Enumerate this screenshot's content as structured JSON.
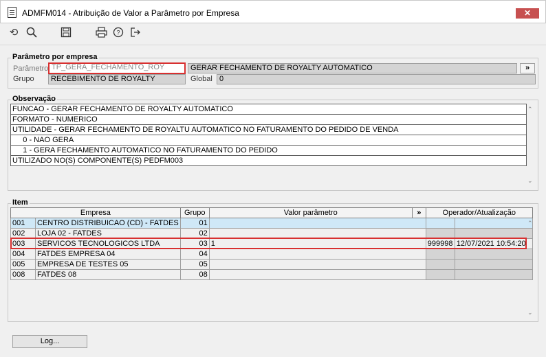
{
  "window": {
    "title": "ADMFM014 - Atribuição de Valor a Parâmetro por Empresa",
    "close_icon": "close-icon"
  },
  "toolbar": {
    "icons": [
      "refresh-icon",
      "search-icon",
      "save-icon",
      "print-icon",
      "help-icon",
      "exit-icon"
    ],
    "refresh_glyph": "⟲",
    "search_glyph": "🔍",
    "save_glyph": "💾",
    "print_glyph": "🖶",
    "help_glyph": "?",
    "exit_glyph": "↦"
  },
  "param_group": {
    "title": "Parâmetro por empresa",
    "parametro_label": "Parâmetro",
    "parametro_value": "TP_GERA_FECHAMENTO_ROY",
    "parametro_desc": "GERAR FECHAMENTO DE ROYALTY AUTOMATICO",
    "lookup_button": "»",
    "grupo_label": "Grupo",
    "grupo_value": "RECEBIMENTO DE ROYALTY",
    "global_label": "Global",
    "global_value": "0"
  },
  "observacao": {
    "title": "Observação",
    "lines": [
      "FUNCAO - GERAR FECHAMENTO DE ROYALTY AUTOMATICO",
      "FORMATO - NUMERICO",
      "UTILIDADE - GERAR FECHAMENTO DE ROYALTU AUTOMATICO NO FATURAMENTO DO PEDIDO DE VENDA",
      "     0 - NAO GERA",
      "     1 - GERA FECHAMENTO AUTOMATICO NO FATURAMENTO DO PEDIDO",
      "UTILIZADO NO(S) COMPONENTE(S) PEDFM003"
    ]
  },
  "item": {
    "title": "Item",
    "headers": {
      "empresa": "Empresa",
      "grupo": "Grupo",
      "valor": "Valor parâmetro",
      "valor_btn": "»",
      "operador": "Operador/Atualização"
    },
    "rows": [
      {
        "code": "001",
        "name": "CENTRO DISTRIBUICAO (CD) - FATDES",
        "grupo": "01",
        "valor": "",
        "operador": "",
        "data": ""
      },
      {
        "code": "002",
        "name": "LOJA 02 - FATDES",
        "grupo": "02",
        "valor": "",
        "operador": "",
        "data": ""
      },
      {
        "code": "003",
        "name": "SERVICOS TECNOLOGICOS LTDA",
        "grupo": "03",
        "valor": "1",
        "operador": "999998",
        "data": "12/07/2021 10:54:20"
      },
      {
        "code": "004",
        "name": "FATDES EMPRESA 04",
        "grupo": "04",
        "valor": "",
        "operador": "",
        "data": ""
      },
      {
        "code": "005",
        "name": "EMPRESA DE TESTES 05",
        "grupo": "05",
        "valor": "",
        "operador": "",
        "data": ""
      },
      {
        "code": "008",
        "name": "FATDES 08",
        "grupo": "08",
        "valor": "",
        "operador": "",
        "data": ""
      }
    ]
  },
  "footer": {
    "log_button": "Log..."
  },
  "colors": {
    "highlight_red": "#d83030",
    "selected_row": "#cfe8f7",
    "close_button": "#c75050"
  }
}
